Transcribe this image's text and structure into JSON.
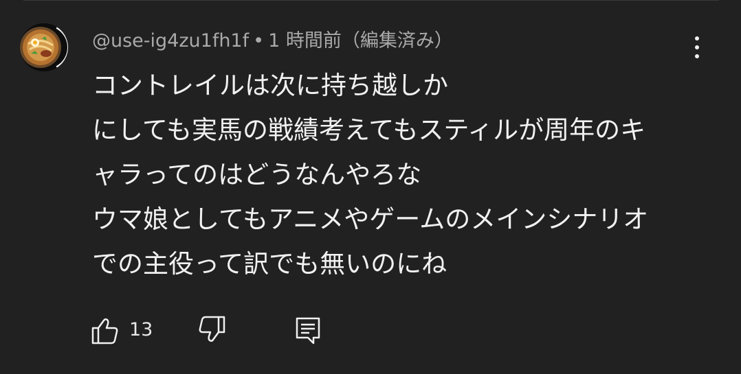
{
  "comment": {
    "author": "@use-ig4zu1fh1f",
    "separator": "•",
    "timestamp": "1 時間前（編集済み）",
    "lines": [
      "コントレイルは次に持ち越しか",
      "にしても実馬の戦績考えてもスティルが周年のキ",
      "ャラってのはどうなんやろな",
      "ウマ娘としてもアニメやゲームのメインシナリオ",
      "での主役って訳でも無いのにね"
    ],
    "like_count": "13"
  },
  "icons": {
    "avatar": "ramen-bowl-avatar",
    "menu": "vertical-dots-icon",
    "like": "thumbs-up-icon",
    "dislike": "thumbs-down-icon",
    "reply": "reply-comment-icon"
  },
  "colors": {
    "background": "#212121",
    "text_primary": "#f1f1f1",
    "text_secondary": "#aaaaaa"
  }
}
